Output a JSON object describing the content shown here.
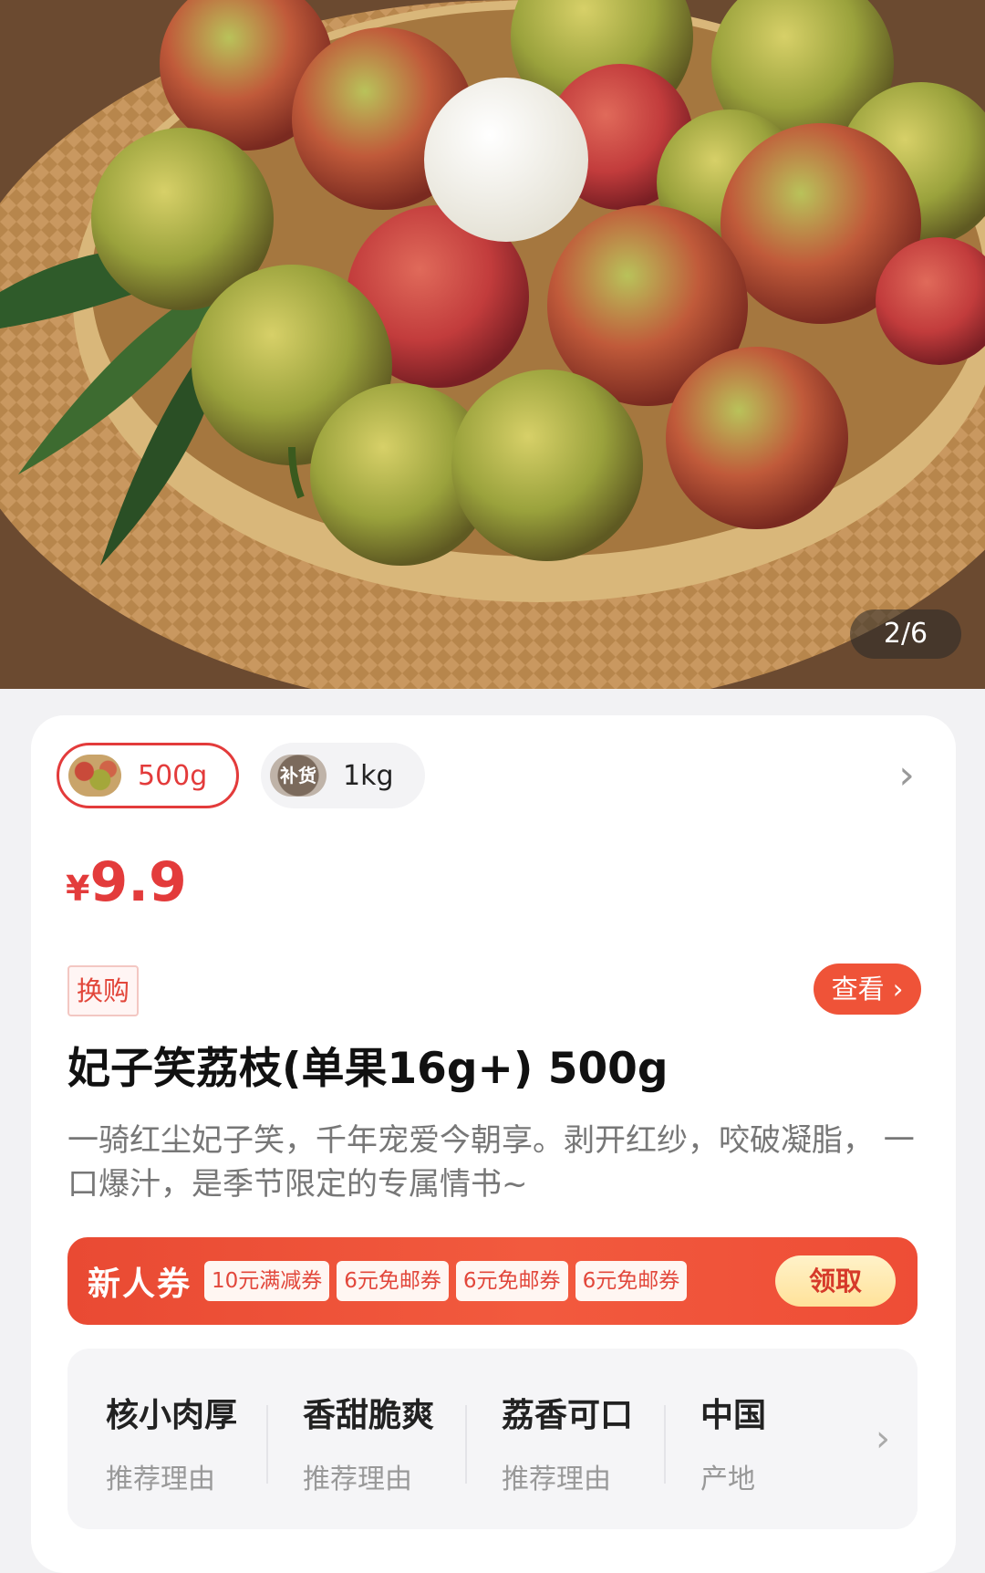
{
  "gallery": {
    "pager": "2/6"
  },
  "specs": [
    {
      "label": "500g",
      "selected": true
    },
    {
      "label": "1kg",
      "badge": "补货",
      "selected": false
    }
  ],
  "price": {
    "currency": "¥",
    "value": "9.9"
  },
  "tag": "换购",
  "view_button": "查看",
  "title": "妃子笑荔枝(单果16g+) 500g",
  "description": "一骑红尘妃子笑，千年宠爱今朝享。剥开红纱，咬破凝脂， 一口爆汁，是季节限定的专属情书~",
  "coupon": {
    "head": "新人券",
    "chips": [
      "10元满减券",
      "6元免邮券",
      "6元免邮券",
      "6元免邮券"
    ],
    "claim": "领取"
  },
  "features": [
    {
      "title": "核小肉厚",
      "sub": "推荐理由"
    },
    {
      "title": "香甜脆爽",
      "sub": "推荐理由"
    },
    {
      "title": "荔香可口",
      "sub": "推荐理由"
    },
    {
      "title": "中国",
      "sub": "产地"
    }
  ],
  "colors": {
    "accent": "#e33b3b",
    "coupon": "#ef5338"
  }
}
